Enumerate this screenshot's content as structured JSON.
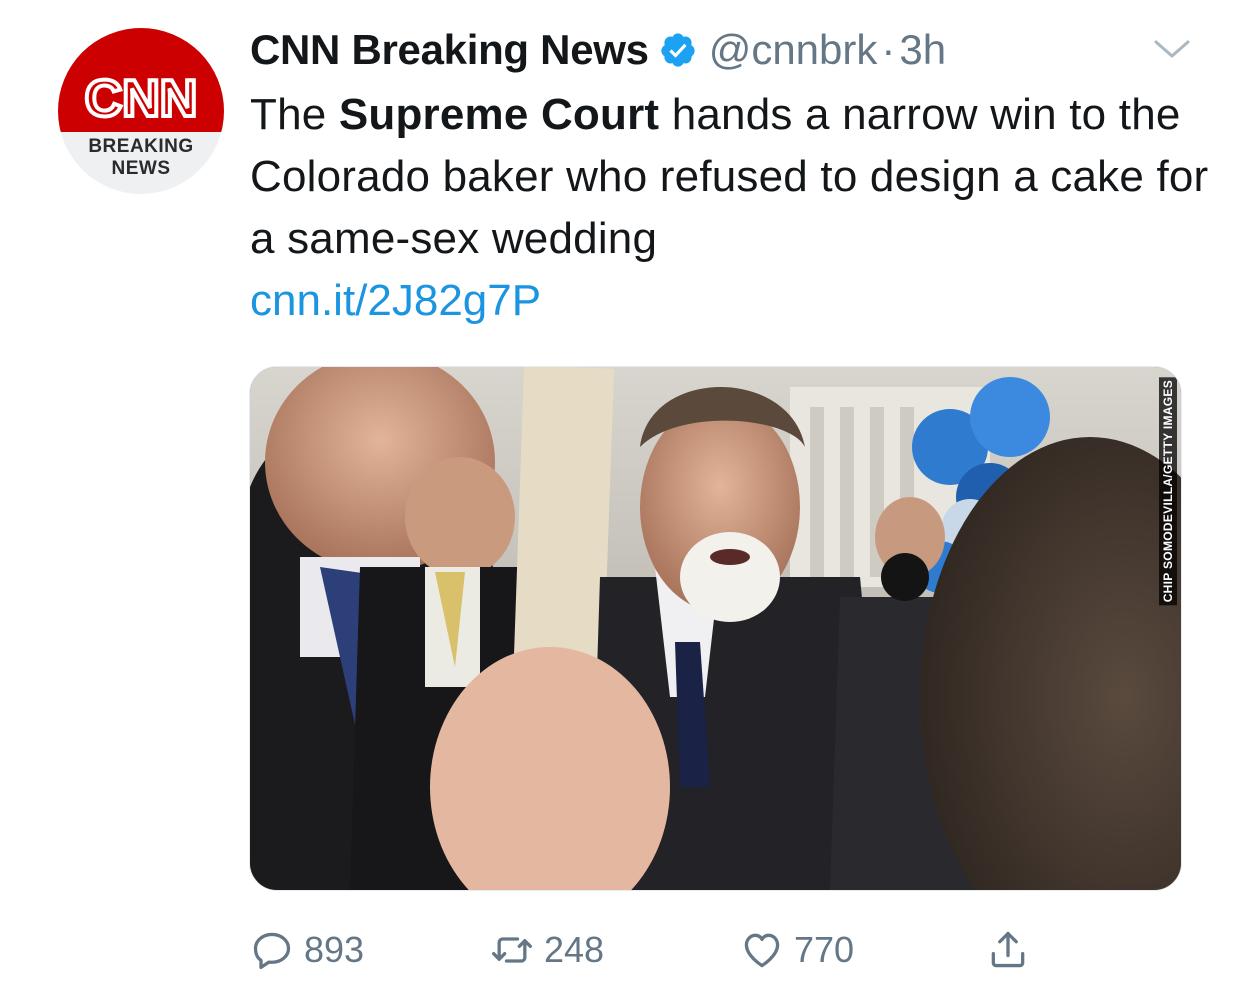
{
  "account": {
    "avatar_logo": "CNN",
    "avatar_line1": "BREAKING",
    "avatar_line2": "NEWS",
    "name": "CNN Breaking News",
    "handle": "@cnnbrk",
    "separator": "·",
    "time": "3h",
    "verified_icon": "verified-badge-icon"
  },
  "tweet": {
    "text_prefix": "The ",
    "text_bold": "Supreme Court",
    "text_suffix": " hands a narrow win to the Colorado baker who refused to design a cake for a same-sex wedding",
    "link": "cnn.it/2J82g7P"
  },
  "media": {
    "credit": "CHIP SOMODEVILLA/GETTY IMAGES"
  },
  "actions": {
    "reply_count": "893",
    "retweet_count": "248",
    "like_count": "770",
    "icons": [
      "reply-icon",
      "retweet-icon",
      "like-icon",
      "share-icon"
    ]
  },
  "colors": {
    "link": "#1b95e0",
    "secondary": "#657786",
    "verified": "#1da1f2",
    "cnn_red": "#cc0000"
  }
}
